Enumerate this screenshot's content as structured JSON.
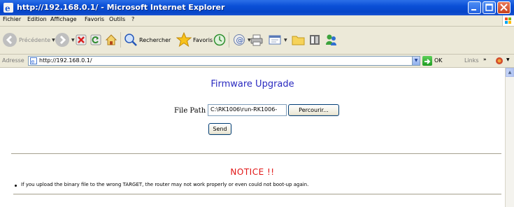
{
  "window": {
    "title": "http://192.168.0.1/ - Microsoft Internet Explorer"
  },
  "menu": {
    "items": [
      "Fichier",
      "Edition",
      "Affichage",
      "Favoris",
      "Outils",
      "?"
    ]
  },
  "toolbar": {
    "back_label": "Précédente",
    "search_label": "Rechercher",
    "favorites_label": "Favoris"
  },
  "address": {
    "label": "Adresse",
    "url": "http://192.168.0.1/",
    "go_label": "OK",
    "links_label": "Links"
  },
  "page": {
    "title": "Firmware Upgrade",
    "file_path_label": "File Path",
    "file_path_value": "C:\\RK1006\\run-RK1006-",
    "browse_label": "Percourir...",
    "send_label": "Send",
    "notice_title": "NOTICE !!",
    "notice_text": "If you upload the binary file to the wrong TARGET, the router may not work properly or even could not boot-up again."
  },
  "colors": {
    "title_bar": "#0a4fd6",
    "page_title": "#2a2ac0",
    "notice": "#e11515"
  },
  "icons": [
    "ie-logo-icon",
    "back-arrow-icon",
    "forward-arrow-icon",
    "stop-icon",
    "refresh-icon",
    "home-icon",
    "search-icon",
    "favorites-star-icon",
    "history-icon",
    "mail-icon",
    "print-icon",
    "edit-icon",
    "folder-icon",
    "messenger-icon",
    "page-icon",
    "go-arrow-icon",
    "windows-flag-icon"
  ]
}
